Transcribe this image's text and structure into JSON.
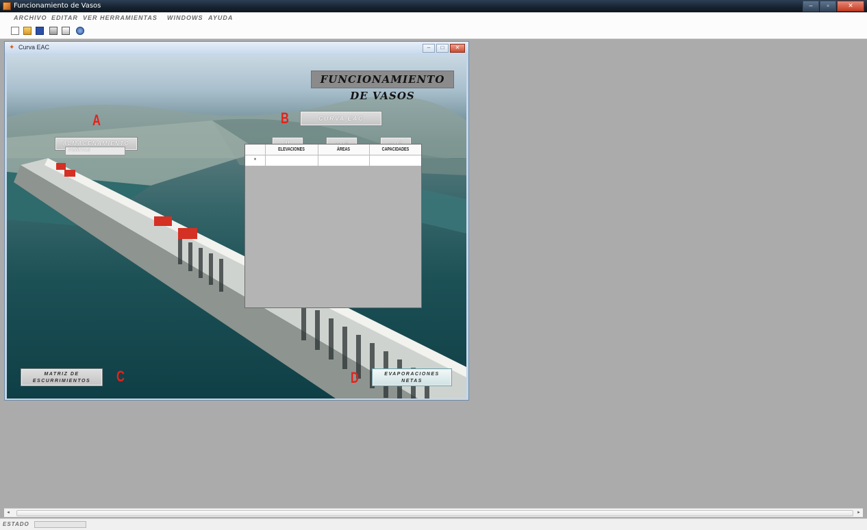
{
  "app": {
    "title": "Funcionamiento de Vasos",
    "window_controls": [
      "–",
      "▫",
      "✕"
    ]
  },
  "menu": [
    "Archivo",
    "Editar",
    "Ver",
    "Herramientas",
    "Windows",
    "Ayuda"
  ],
  "toolbar_icons": [
    "new-icon",
    "open-folder-icon",
    "save-icon",
    "print-icon",
    "print-preview-icon",
    "help-icon"
  ],
  "child_window": {
    "title": "Curva EAC",
    "controls": [
      "–",
      "□",
      "✕"
    ]
  },
  "form": {
    "heading": "FUNCIONAMIENTO DE VASOS",
    "labels": {
      "a": "A",
      "b": "B",
      "c": "C",
      "d": "D"
    },
    "almacenamiento_button": "Almacenamiento",
    "combo_value": "Peñitas",
    "curva_eac_button": "Curva EAC",
    "unit_buttons": {
      "m": "M",
      "km2": "KM",
      "km2_sup": "2",
      "hm3": "HM",
      "hm3_sup": "3"
    },
    "matriz_button_line1": "Matriz de",
    "matriz_button_line2": "Escurrimientos",
    "evaporaciones_button_line1": "Evaporaciones",
    "evaporaciones_button_line2": "Netas"
  },
  "grid": {
    "columns": [
      "ELEVACIONES",
      "ÁREAS",
      "CAPACIDADES"
    ],
    "new_row_marker": "*"
  },
  "statusbar": {
    "label": "Estado",
    "progress": 0
  },
  "colors": {
    "accent_label": "#e8201a",
    "mdi_background": "#ababab",
    "title_plate": "#8b8b8b"
  }
}
